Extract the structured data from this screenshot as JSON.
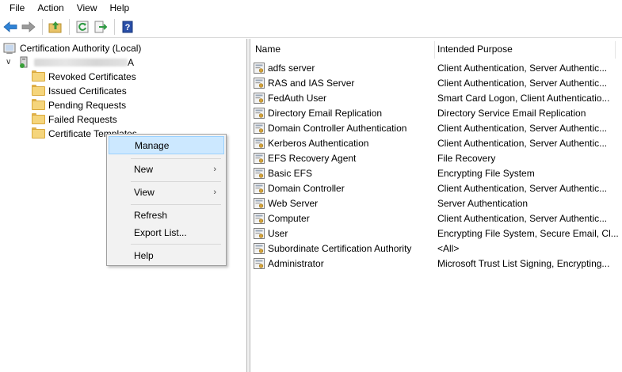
{
  "menu": [
    "File",
    "Action",
    "View",
    "Help"
  ],
  "toolbar": [
    "back-arrow-icon",
    "forward-arrow-icon",
    "up-folder-icon",
    "refresh-icon",
    "export-icon",
    "help-book-icon"
  ],
  "tree": {
    "root": "Certification Authority (Local)",
    "ca_suffix": "A",
    "children": [
      "Revoked Certificates",
      "Issued Certificates",
      "Pending Requests",
      "Failed Requests",
      "Certificate Templates"
    ]
  },
  "list": {
    "headers": [
      "Name",
      "Intended Purpose"
    ],
    "rows": [
      {
        "name": "adfs server",
        "purpose": "Client Authentication, Server Authentic..."
      },
      {
        "name": "RAS and IAS Server",
        "purpose": "Client Authentication, Server Authentic..."
      },
      {
        "name": "FedAuth User",
        "purpose": "Smart Card Logon, Client Authenticatio..."
      },
      {
        "name": "Directory Email Replication",
        "purpose": "Directory Service Email Replication"
      },
      {
        "name": "Domain Controller Authentication",
        "purpose": "Client Authentication, Server Authentic..."
      },
      {
        "name": "Kerberos Authentication",
        "purpose": "Client Authentication, Server Authentic..."
      },
      {
        "name": "EFS Recovery Agent",
        "purpose": "File Recovery"
      },
      {
        "name": "Basic EFS",
        "purpose": "Encrypting File System"
      },
      {
        "name": "Domain Controller",
        "purpose": "Client Authentication, Server Authentic..."
      },
      {
        "name": "Web Server",
        "purpose": "Server Authentication"
      },
      {
        "name": "Computer",
        "purpose": "Client Authentication, Server Authentic..."
      },
      {
        "name": "User",
        "purpose": "Encrypting File System, Secure Email, Cl..."
      },
      {
        "name": "Subordinate Certification Authority",
        "purpose": "<All>"
      },
      {
        "name": "Administrator",
        "purpose": "Microsoft Trust List Signing, Encrypting..."
      }
    ]
  },
  "context_menu": {
    "items": [
      "Manage",
      "New",
      "View",
      "Refresh",
      "Export List...",
      "Help"
    ],
    "highlighted": "Manage"
  }
}
